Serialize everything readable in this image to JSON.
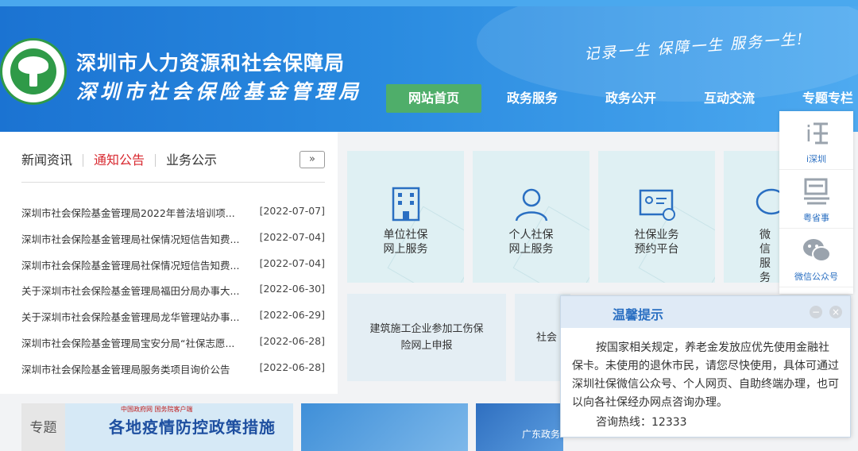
{
  "header": {
    "org_name_1": "深圳市人力资源和社会保障局",
    "org_name_2": "深圳市社会保险基金管理局",
    "slogan": "记录一生 保障一生 服务一生!"
  },
  "nav": {
    "items": [
      "网站首页",
      "政务服务",
      "政务公开",
      "互动交流",
      "专题专栏"
    ]
  },
  "news": {
    "tabs": [
      "新闻资讯",
      "通知公告",
      "业务公示"
    ],
    "more_label": "»",
    "rows": [
      {
        "title": "深圳市社会保险基金管理局2022年普法培训项...",
        "date": "[2022-07-07]"
      },
      {
        "title": "深圳市社会保险基金管理局社保情况短信告知费...",
        "date": "[2022-07-04]"
      },
      {
        "title": "深圳市社会保险基金管理局社保情况短信告知费...",
        "date": "[2022-07-04]"
      },
      {
        "title": "关于深圳市社会保险基金管理局福田分局办事大...",
        "date": "[2022-06-30]"
      },
      {
        "title": "关于深圳市社会保险基金管理局龙华管理站办事...",
        "date": "[2022-06-29]"
      },
      {
        "title": "深圳市社会保险基金管理局宝安分局“社保志愿...",
        "date": "[2022-06-28]"
      },
      {
        "title": "深圳市社会保险基金管理局服务类项目询价公告",
        "date": "[2022-06-28]"
      }
    ]
  },
  "services": {
    "tiles": [
      {
        "line1": "单位社保",
        "line2": "网上服务",
        "icon": "building-icon"
      },
      {
        "line1": "个人社保",
        "line2": "网上服务",
        "icon": "person-icon"
      },
      {
        "line1": "社保业务",
        "line2": "预约平台",
        "icon": "appointment-icon"
      },
      {
        "line1": "微信",
        "line2": "服务",
        "icon": "wechat-icon"
      }
    ],
    "row2": [
      {
        "line1": "建筑施工企业参加工伤保",
        "line2": "险网上申报"
      },
      {
        "line1": "社会",
        "line2": ""
      }
    ]
  },
  "sidebar": {
    "items": [
      {
        "label": "i深圳",
        "icon": "ishenzhen-icon"
      },
      {
        "label": "粤省事",
        "icon": "yueshengshi-icon"
      },
      {
        "label": "微信公众号",
        "icon": "wechat-icon"
      }
    ]
  },
  "banners": {
    "zhuanti_label": "专题",
    "epidemic_title": "各地疫情防控政策措施",
    "epidemic_top": "中国政府网 国务院客户端",
    "gd_label": "广东政务"
  },
  "popup": {
    "title": "温馨提示",
    "minimize_label": "−",
    "close_label": "×",
    "body": "按国家相关规定，养老金发放应优先使用金融社保卡。未使用的退休市民，请您尽快使用，具体可通过深圳社保微信公众号、个人网页、自助终端办理，也可以向各社保经办网点咨询办理。",
    "hotline": "咨询热线：12333"
  },
  "colors": {
    "header_blue": "#1b73d2",
    "nav_active": "#4fae6a",
    "tab_active": "#d8282f",
    "tile_bg": "#dff0f3",
    "icon_blue": "#2a6fc2"
  }
}
